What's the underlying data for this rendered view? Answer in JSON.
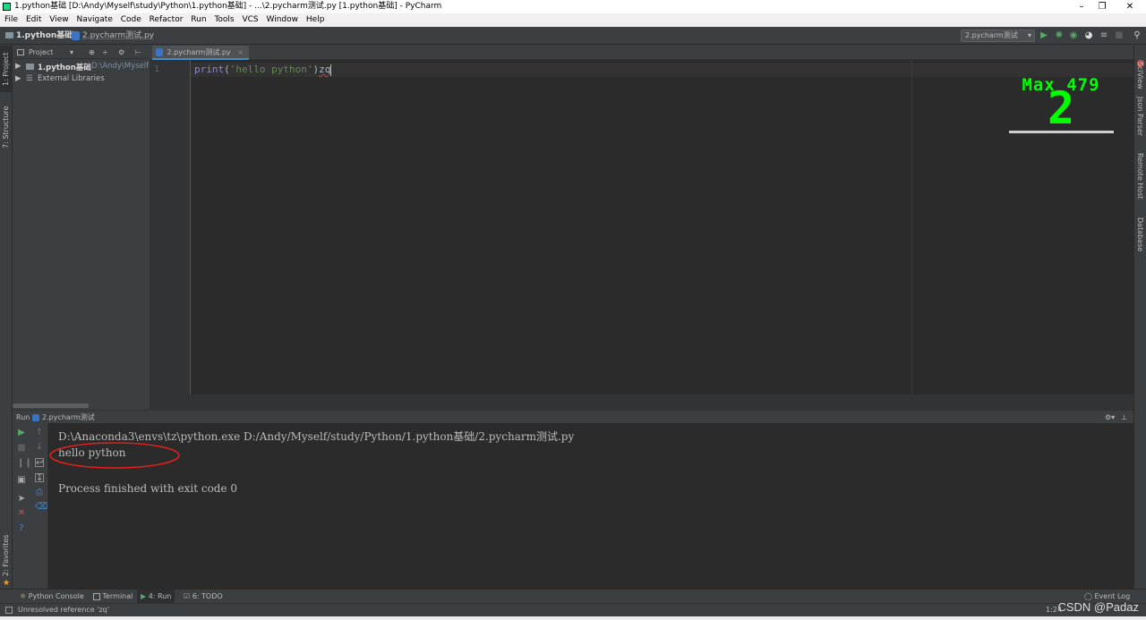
{
  "window": {
    "title": "1.python基础 [D:\\Andy\\Myself\\study\\Python\\1.python基础] - ...\\2.pycharm测试.py [1.python基础] - PyCharm"
  },
  "menu": [
    "File",
    "Edit",
    "View",
    "Navigate",
    "Code",
    "Refactor",
    "Run",
    "Tools",
    "VCS",
    "Window",
    "Help"
  ],
  "navbar": {
    "crumb_project": "1.python基础",
    "crumb_file": "2.pycharm测试.py",
    "run_config": "2.pycharm测试"
  },
  "left_strip": {
    "project": "1: Project",
    "structure": "7: Structure",
    "favorites": "2: Favorites"
  },
  "right_strip": {
    "sciview": "SciView",
    "json": "Json Parser",
    "remote": "Remote Host",
    "database": "Database"
  },
  "project_panel": {
    "header": "Project",
    "root_name": "1.python基础",
    "root_path": "D:\\Andy\\Myself",
    "external": "External Libraries"
  },
  "editor": {
    "tab": "2.pycharm测试.py",
    "line_number": "1",
    "code_fn": "print",
    "code_open": "(",
    "code_str": "'hello python'",
    "code_close": ")",
    "code_extra": "zq"
  },
  "combo": {
    "max_label": "Max 479",
    "count": "2"
  },
  "run_panel": {
    "title": "Run",
    "config": "2.pycharm测试",
    "command": "D:\\Anaconda3\\envs\\tz\\python.exe D:/Andy/Myself/study/Python/1.python基础/2.pycharm测试.py",
    "output": "hello python",
    "finished": "Process finished with exit code 0"
  },
  "bottom_tabs": {
    "python_console": "Python Console",
    "terminal": "Terminal",
    "run": "4: Run",
    "todo": "6: TODO",
    "event_log": "Event Log"
  },
  "status": {
    "message": "Unresolved reference 'zq'",
    "position": "1:24",
    "watermark": "CSDN @Padaz"
  },
  "colors": {
    "editor_bg": "#2b2b2b",
    "panel_bg": "#3c3f41",
    "combo_green": "#00ff00",
    "annotation_red": "#e0201b"
  }
}
